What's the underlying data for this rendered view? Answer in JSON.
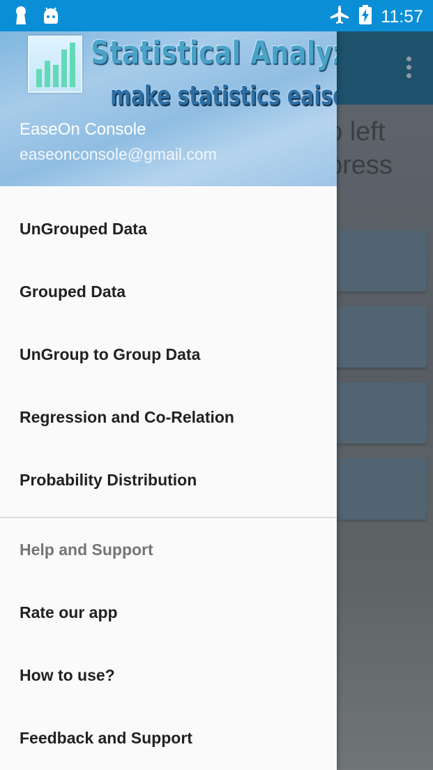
{
  "status_bar": {
    "time": "11:57",
    "icons": [
      "keyhole-icon",
      "android-icon",
      "airplane-mode-icon",
      "battery-charging-icon"
    ]
  },
  "background": {
    "text_line1": "p left",
    "text_line2": "press"
  },
  "drawer": {
    "header": {
      "brand_title": "Statistical Analyzer",
      "brand_subtitle": "make statistics eaiser",
      "account_name": "EaseOn Console",
      "account_email": "easeonconsole@gmail.com"
    },
    "primary_items": [
      {
        "label": "UnGrouped Data"
      },
      {
        "label": "Grouped Data"
      },
      {
        "label": "UnGroup to Group Data"
      },
      {
        "label": "Regression and Co-Relation"
      },
      {
        "label": "Probability Distribution"
      }
    ],
    "support_header": "Help and Support",
    "support_items": [
      {
        "label": "Rate our app"
      },
      {
        "label": "How to use?"
      },
      {
        "label": "Feedback and Support"
      }
    ]
  },
  "colors": {
    "status_bar": "#0a8fd6",
    "toolbar": "#0e5c84",
    "drawer_bg": "#fafafa",
    "menu_text": "#212121",
    "subheader_text": "#757575"
  }
}
